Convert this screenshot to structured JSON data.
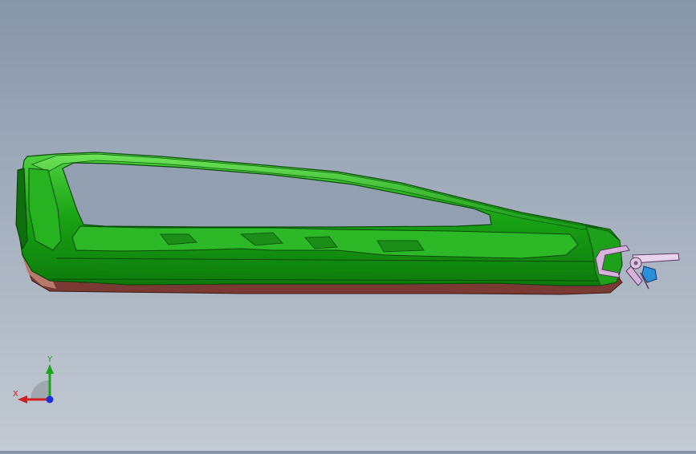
{
  "viewport": {
    "background_top": "#8795a9",
    "background_bottom": "#c3cad3",
    "model_color": "#1fa41a",
    "clamp_color": "#d7b2dc"
  },
  "triad": {
    "x_label": "X",
    "y_label": "Y",
    "x_color": "#d02020",
    "y_color": "#1aa51a",
    "z_color": "#1d2fd8"
  }
}
